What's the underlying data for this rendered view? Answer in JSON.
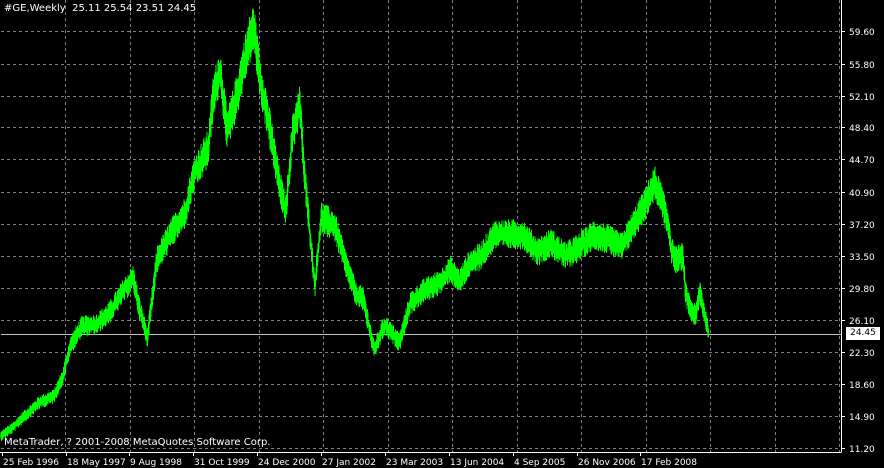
{
  "header": {
    "symbol_timeframe": "#GE,Weekly",
    "ohlc": "25.11 25.54 23.51 24.45"
  },
  "footer": {
    "copyright": "MetaTrader, ? 2001-2008 MetaQuotes Software Corp."
  },
  "current_price_label": "24.45",
  "colors": {
    "background": "#000000",
    "grid": "#808080",
    "series": "#00ff00",
    "text": "#ffffff",
    "price_box": "#ffffff"
  },
  "chart_data": {
    "type": "line",
    "title": "",
    "xlabel": "",
    "ylabel": "",
    "grid": true,
    "x_ticks": [
      "25 Feb 1996",
      "18 May 1997",
      "9 Aug 1998",
      "31 Oct 1999",
      "24 Dec 2000",
      "27 Jan 2002",
      "23 Mar 2003",
      "13 Jun 2004",
      "4 Sep 2005",
      "26 Nov 2006",
      "17 Feb 2008"
    ],
    "y_ticks": [
      "59.60",
      "55.80",
      "52.10",
      "48.40",
      "44.70",
      "40.90",
      "37.20",
      "33.50",
      "29.80",
      "26.10",
      "22.30",
      "18.60",
      "14.90",
      "11.20"
    ],
    "ylim": [
      11.2,
      59.6
    ],
    "current_price": 24.45,
    "series": [
      {
        "values": [
          {
            "x": "1996-02-25",
            "y": 12.6
          },
          {
            "x": "1996-05-01",
            "y": 13.4
          },
          {
            "x": "1996-08-01",
            "y": 15.0
          },
          {
            "x": "1996-11-01",
            "y": 16.5
          },
          {
            "x": "1997-02-01",
            "y": 17.2
          },
          {
            "x": "1997-04-01",
            "y": 19.5
          },
          {
            "x": "1997-05-18",
            "y": 23.0
          },
          {
            "x": "1997-08-01",
            "y": 25.3
          },
          {
            "x": "1997-11-01",
            "y": 25.5
          },
          {
            "x": "1998-02-01",
            "y": 27.0
          },
          {
            "x": "1998-05-01",
            "y": 29.5
          },
          {
            "x": "1998-07-01",
            "y": 31.0
          },
          {
            "x": "1998-08-09",
            "y": 27.5
          },
          {
            "x": "1998-10-01",
            "y": 24.0
          },
          {
            "x": "1998-12-01",
            "y": 33.0
          },
          {
            "x": "1999-03-01",
            "y": 36.0
          },
          {
            "x": "1999-06-01",
            "y": 38.5
          },
          {
            "x": "1999-08-01",
            "y": 43.0
          },
          {
            "x": "1999-10-31",
            "y": 46.0
          },
          {
            "x": "1999-12-01",
            "y": 52.0
          },
          {
            "x": "2000-01-15",
            "y": 55.0
          },
          {
            "x": "2000-03-01",
            "y": 48.0
          },
          {
            "x": "2000-05-01",
            "y": 52.0
          },
          {
            "x": "2000-07-15",
            "y": 58.0
          },
          {
            "x": "2000-08-20",
            "y": 60.0
          },
          {
            "x": "2000-10-01",
            "y": 54.0
          },
          {
            "x": "2000-11-15",
            "y": 50.0
          },
          {
            "x": "2000-12-24",
            "y": 46.0
          },
          {
            "x": "2001-02-01",
            "y": 42.0
          },
          {
            "x": "2001-03-15",
            "y": 38.5
          },
          {
            "x": "2001-05-01",
            "y": 48.0
          },
          {
            "x": "2001-06-15",
            "y": 51.0
          },
          {
            "x": "2001-07-15",
            "y": 43.0
          },
          {
            "x": "2001-09-20",
            "y": 30.0
          },
          {
            "x": "2001-11-01",
            "y": 38.0
          },
          {
            "x": "2002-01-27",
            "y": 37.0
          },
          {
            "x": "2002-04-01",
            "y": 33.0
          },
          {
            "x": "2002-06-15",
            "y": 29.0
          },
          {
            "x": "2002-08-01",
            "y": 28.5
          },
          {
            "x": "2002-10-09",
            "y": 22.5
          },
          {
            "x": "2002-12-15",
            "y": 25.5
          },
          {
            "x": "2003-03-23",
            "y": 23.5
          },
          {
            "x": "2003-06-01",
            "y": 28.0
          },
          {
            "x": "2003-09-01",
            "y": 29.5
          },
          {
            "x": "2003-12-15",
            "y": 30.5
          },
          {
            "x": "2004-02-15",
            "y": 32.0
          },
          {
            "x": "2004-04-15",
            "y": 30.5
          },
          {
            "x": "2004-06-13",
            "y": 32.5
          },
          {
            "x": "2004-09-01",
            "y": 33.5
          },
          {
            "x": "2004-12-01",
            "y": 36.0
          },
          {
            "x": "2005-03-01",
            "y": 36.0
          },
          {
            "x": "2005-06-01",
            "y": 36.0
          },
          {
            "x": "2005-09-04",
            "y": 34.0
          },
          {
            "x": "2005-12-01",
            "y": 35.0
          },
          {
            "x": "2006-03-01",
            "y": 33.5
          },
          {
            "x": "2006-06-01",
            "y": 34.5
          },
          {
            "x": "2006-09-01",
            "y": 36.0
          },
          {
            "x": "2006-11-26",
            "y": 35.5
          },
          {
            "x": "2007-03-01",
            "y": 34.5
          },
          {
            "x": "2007-05-15",
            "y": 37.0
          },
          {
            "x": "2007-08-01",
            "y": 39.5
          },
          {
            "x": "2007-10-01",
            "y": 42.0
          },
          {
            "x": "2007-11-15",
            "y": 40.0
          },
          {
            "x": "2007-12-31",
            "y": 37.0
          },
          {
            "x": "2008-01-20",
            "y": 34.0
          },
          {
            "x": "2008-02-17",
            "y": 33.0
          },
          {
            "x": "2008-04-01",
            "y": 33.5
          },
          {
            "x": "2008-04-20",
            "y": 29.0
          },
          {
            "x": "2008-06-01",
            "y": 27.0
          },
          {
            "x": "2008-06-25",
            "y": 26.5
          },
          {
            "x": "2008-07-20",
            "y": 29.5
          },
          {
            "x": "2008-09-15",
            "y": 24.45
          }
        ]
      }
    ]
  }
}
